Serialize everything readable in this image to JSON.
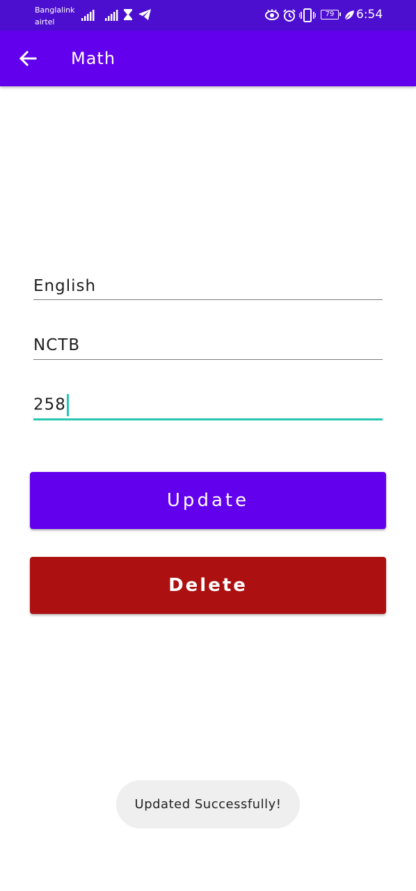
{
  "status_bar": {
    "carrier_1": "Banglalink",
    "carrier_2": "airtel",
    "battery": "79",
    "time": "6:54",
    "icons": [
      "signal-icon",
      "signal-icon",
      "hourglass-icon",
      "telegram-icon",
      "eye-icon",
      "alarm-icon",
      "vibrate-icon",
      "battery-icon",
      "leaf-icon"
    ]
  },
  "app_bar": {
    "title": "Math",
    "back_icon": "arrow-left-icon"
  },
  "form": {
    "field_1": "English",
    "field_2": "NCTB",
    "field_3": "258"
  },
  "buttons": {
    "update_label": "Update",
    "delete_label": "Delete"
  },
  "toast": {
    "message": "Updated Successfully!"
  },
  "colors": {
    "status_bar": "#4c0fd0",
    "primary": "#6200ee",
    "delete": "#ac1010",
    "accent": "#26c6b3",
    "toast_bg": "#efefef"
  }
}
